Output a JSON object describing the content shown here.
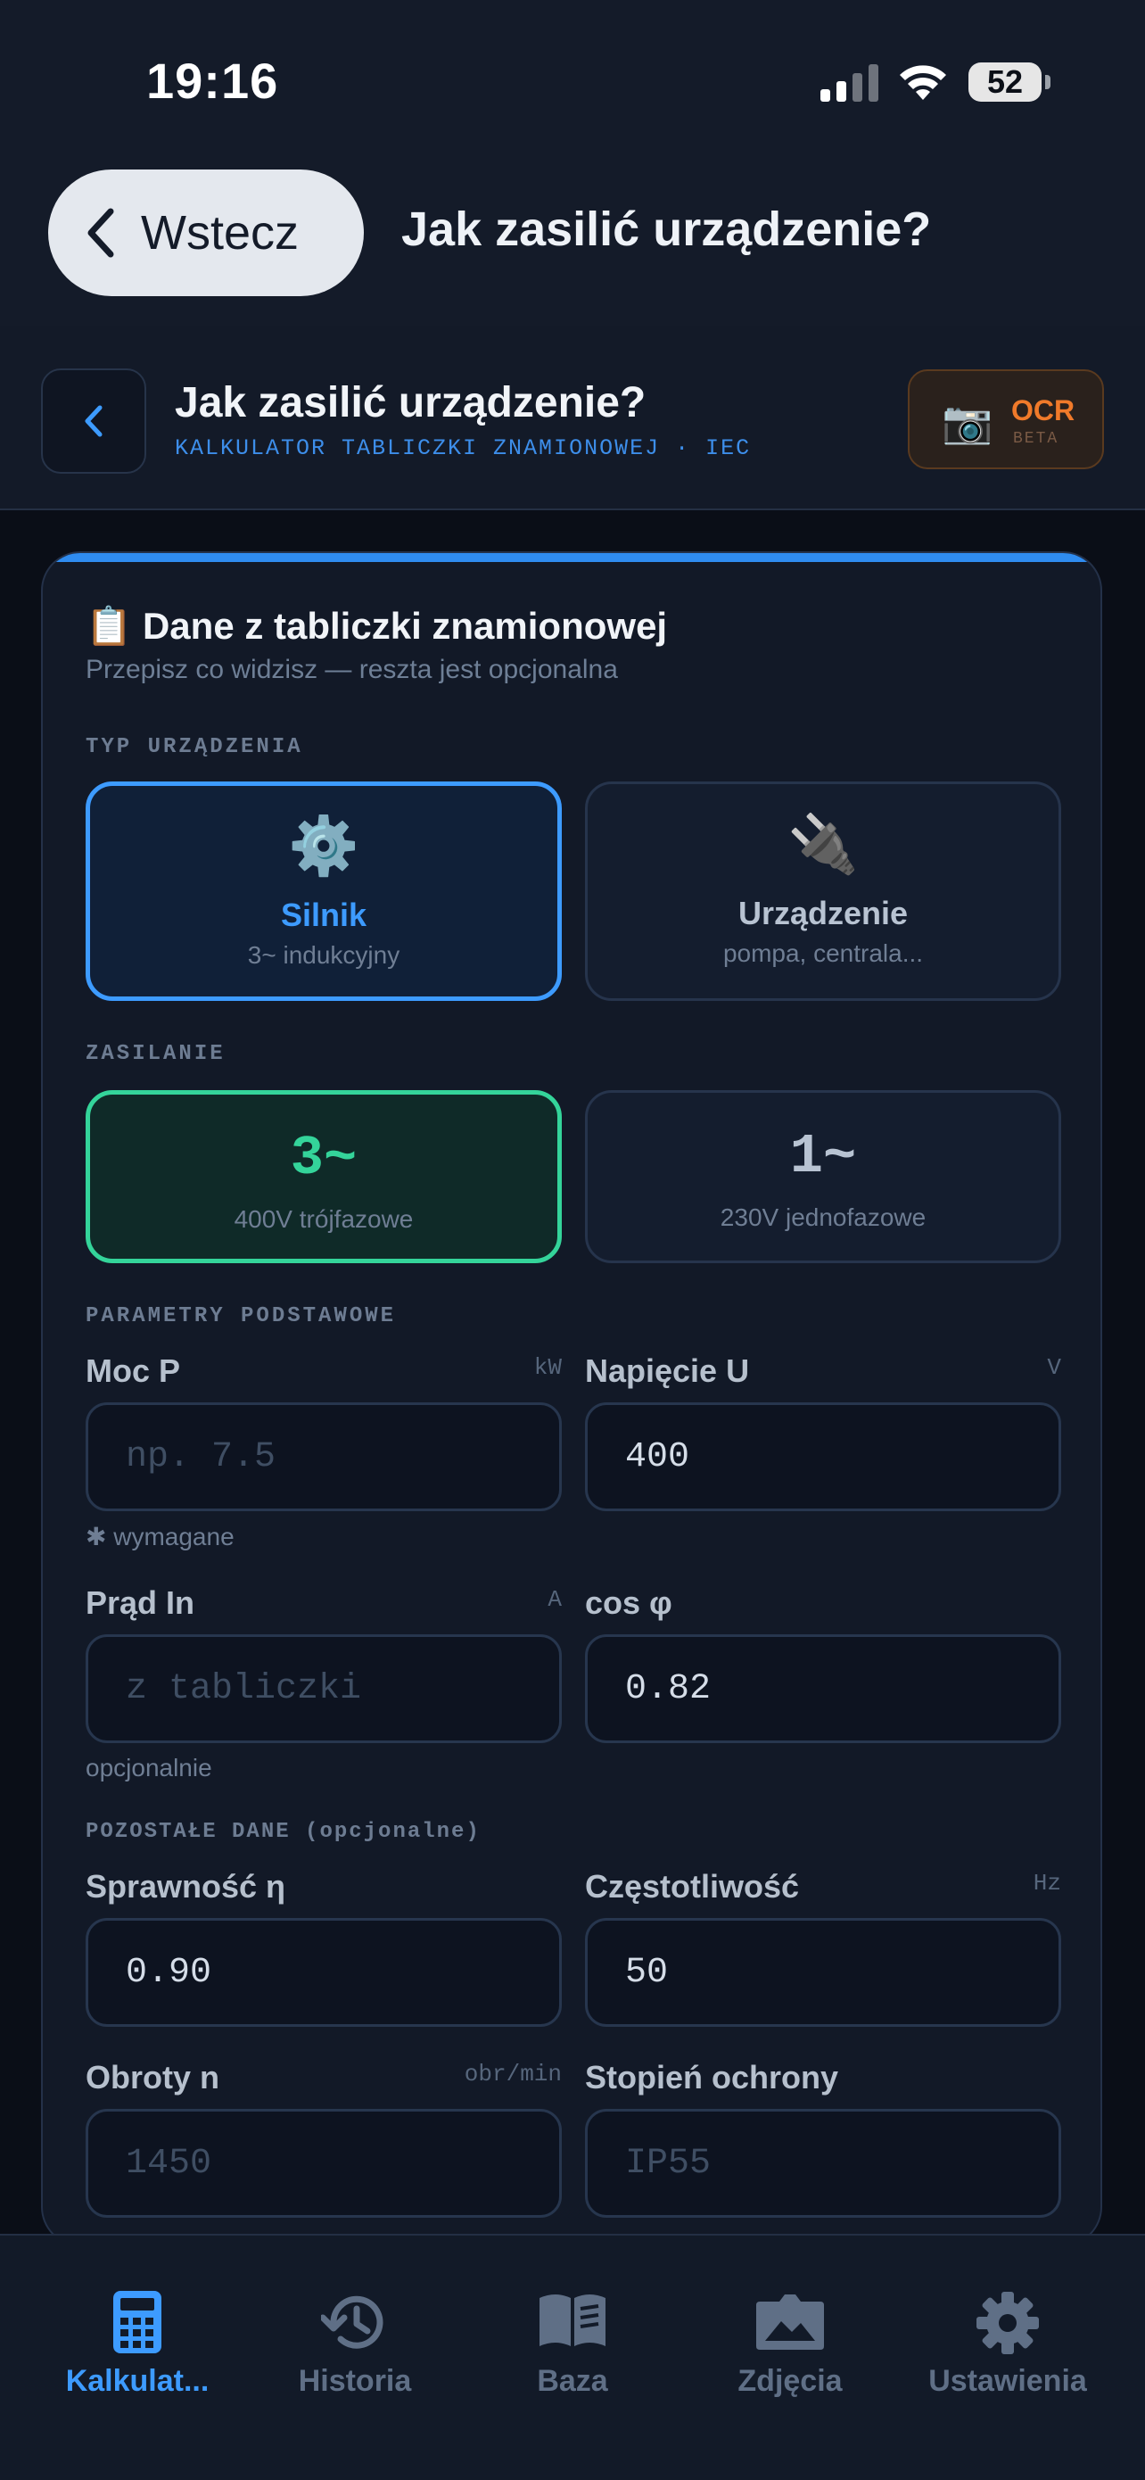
{
  "status": {
    "time": "19:16",
    "battery": "52"
  },
  "nav": {
    "back_label": "Wstecz",
    "title": "Jak zasilić urządzenie?"
  },
  "header": {
    "title": "Jak zasilić urządzenie?",
    "subtitle": "KALKULATOR TABLICZKI ZNAMIONOWEJ · IEC",
    "ocr_label": "OCR",
    "ocr_badge": "BETA",
    "ocr_icon": "camera-icon"
  },
  "card": {
    "icon": "clipboard-icon",
    "title": "Dane z tabliczki znamionowej",
    "subtitle": "Przepisz co widzisz — reszta jest opcjonalna",
    "device_type": {
      "label": "TYP URZĄDZENIA",
      "options": [
        {
          "icon": "gear-icon",
          "name": "Silnik",
          "desc": "3~ indukcyjny",
          "selected": true
        },
        {
          "icon": "plug-icon",
          "name": "Urządzenie",
          "desc": "pompa, centrala...",
          "selected": false
        }
      ]
    },
    "supply": {
      "label": "ZASILANIE",
      "options": [
        {
          "symbol": "3~",
          "desc": "400V trójfazowe",
          "selected": true
        },
        {
          "symbol": "1~",
          "desc": "230V jednofazowe",
          "selected": false
        }
      ]
    },
    "basic": {
      "label": "PARAMETRY PODSTAWOWE",
      "power": {
        "label": "Moc P",
        "unit": "kW",
        "value": "",
        "placeholder": "np. 7.5",
        "hint": "✱ wymagane"
      },
      "voltage": {
        "label": "Napięcie U",
        "unit": "V",
        "value": "400"
      },
      "current": {
        "label": "Prąd In",
        "unit": "A",
        "value": "",
        "placeholder": "z tabliczki",
        "hint": "opcjonalnie"
      },
      "cosphi": {
        "label": "cos φ",
        "value": "0.82"
      }
    },
    "other": {
      "label": "POZOSTAŁE DANE (opcjonalne)",
      "efficiency": {
        "label": "Sprawność η",
        "value": "0.90"
      },
      "frequency": {
        "label": "Częstotliwość",
        "unit": "Hz",
        "value": "50"
      },
      "speed": {
        "label": "Obroty n",
        "unit": "obr/min",
        "value": "",
        "placeholder": "1450"
      },
      "protection": {
        "label": "Stopień ochrony",
        "value": "",
        "placeholder": "IP55"
      }
    }
  },
  "tabs": [
    {
      "label": "Kalkulat...",
      "icon": "calculator-icon",
      "active": true
    },
    {
      "label": "Historia",
      "icon": "history-icon",
      "active": false
    },
    {
      "label": "Baza",
      "icon": "book-icon",
      "active": false
    },
    {
      "label": "Zdjęcia",
      "icon": "photos-icon",
      "active": false
    },
    {
      "label": "Ustawienia",
      "icon": "gear-icon",
      "active": false
    }
  ],
  "colors": {
    "accent": "#3d9bff",
    "green": "#34d49a",
    "ocr": "#f07a2a",
    "background": "#0a0e17"
  }
}
